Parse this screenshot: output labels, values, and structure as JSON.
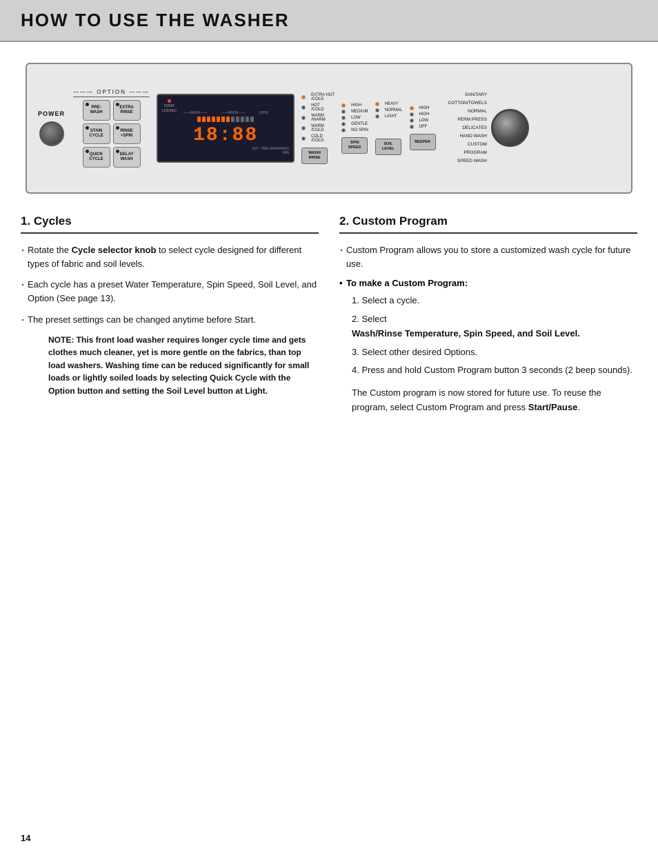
{
  "header": {
    "title": "HOW TO USE THE WASHER"
  },
  "washer": {
    "power_label": "POWER",
    "option_label": "OPTION",
    "door_locked": [
      "DOOR",
      "LOCKED"
    ],
    "display_time": "18:88",
    "min_label": "MIN",
    "wash_label": "WASH",
    "rinse_label": "RINSE",
    "spin_label": "SPIN",
    "est_time_label": "EST. TIME REMAINING",
    "buttons": {
      "pre_wash": "PRE-\nWASH",
      "extra_rinse": "EXTRA\nRINSE",
      "stain_cycle": "STAIN\nCYCLE",
      "rinse_spin": "RINSE\n+SPIN",
      "quick_cycle": "QUICK\nCYCLE",
      "delay_wash": "DELAY\nWASH",
      "wash_rinse": "WASH/\nRINSE",
      "spin_speed": "SPIN\nSPEED",
      "soil_level": "SOIL\nLEVEL",
      "beeper": "BEEPER"
    },
    "temp_options": [
      "EXTRA HOT /COLD",
      "HOT /COLD",
      "WARM /WARM",
      "WARM /COLD",
      "COLD /COLD"
    ],
    "spin_options": [
      "HIGH",
      "MEDIUM",
      "LOW",
      "GENTLE",
      "NO SPIN"
    ],
    "soil_options": [
      "HEAVY",
      "NORMAL",
      "LIGHT"
    ],
    "extra_options": [
      "HIGH",
      "HIGH",
      "LOW",
      "OFF"
    ],
    "cycles": [
      "SANITARY",
      "COTTON/TOWELS",
      "NORMAL",
      "PERM PRESS",
      "DELICATES",
      "HAND WASH",
      "CUSTOM PROGRAM",
      "SPEED WASH"
    ]
  },
  "section1": {
    "title": "1. Cycles",
    "bullet1": "Rotate the Cycle selector knob  to select cycle designed for different types of fabric and soil levels.",
    "bullet1_bold": "Cycle selector knob",
    "bullet2": "Each cycle has a preset Water Temperature, Spin Speed, Soil Level, and Option (See page 13).",
    "bullet3": "The preset settings can be changed anytime before Start.",
    "note_label": "NOTE:",
    "note_text": "This front load washer requires longer cycle time and gets clothes much cleaner, yet is more gentle on the fabrics, than top load washers. Washing time can be reduced significantly for small loads or lightly soiled loads by selecting Quick Cycle with the Option button and setting the Soil Level button at Light."
  },
  "section2": {
    "title": "2. Custom Program",
    "bullet1_pre": "Custom Program allows you to store a customized wash cycle for future use.",
    "bold_header": "• To make a Custom Program:",
    "step1": "Select a cycle.",
    "step2_pre": "Select",
    "step2_bold": "Wash/Rinse Temperature, Spin Speed, and Soil Level.",
    "step3": "Select other desired Options.",
    "step4": "Press and hold Custom Program button 3 seconds (2 beep sounds).",
    "para": "The Custom program is now stored for future use. To reuse the program, select Custom Program and press ",
    "para_bold": "Start/Pause",
    "para_end": "."
  },
  "page_number": "14"
}
